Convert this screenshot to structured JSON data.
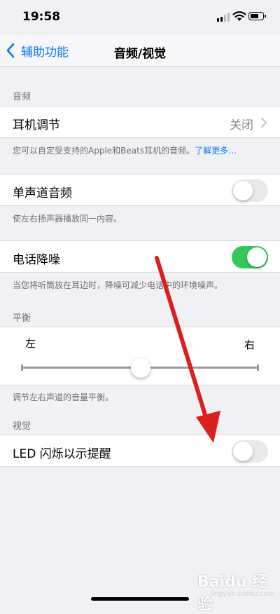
{
  "status": {
    "time": "19:58"
  },
  "nav": {
    "back_label": "辅助功能",
    "title": "音频/视觉"
  },
  "audio": {
    "header": "音频",
    "headphone": {
      "label": "耳机调节",
      "value": "关闭"
    },
    "headphone_footer": "您可以自定受支持的Apple和Beats耳机的音频。",
    "headphone_footer_link": "了解更多…",
    "mono": {
      "label": "单声道音频",
      "on": false
    },
    "mono_footer": "使左右扬声器播放同一内容。",
    "noise": {
      "label": "电话降噪",
      "on": true
    },
    "noise_footer": "当您将听筒放在耳边时，降噪可减少电话中的环境噪声。"
  },
  "balance": {
    "header": "平衡",
    "left": "左",
    "right": "右",
    "value": 0.5,
    "footer": "调节左右声道的音量平衡。"
  },
  "visual": {
    "header": "视觉",
    "led": {
      "label": "LED 闪烁以示提醒",
      "on": false
    }
  },
  "watermark": {
    "text": "Baidu 经验",
    "sub": "jingyan.baidu.com"
  },
  "colors": {
    "accent": "#0a7aff",
    "switch_on": "#35c759",
    "annotation_arrow": "#d9201e"
  }
}
